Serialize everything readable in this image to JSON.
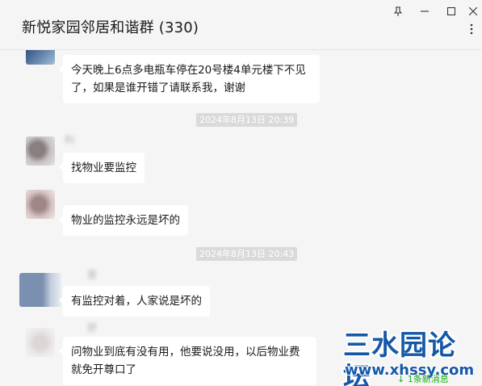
{
  "window": {
    "title": "新悦家园邻居和谐群 (330)",
    "controls": {
      "pin": "⊥",
      "minimize": "—",
      "maximize": "□",
      "close": "✕",
      "more": "⋮"
    }
  },
  "messages": [
    {
      "text": "今天晚上6点多电瓶车停在20号楼4单元楼下不见了，如果是谁开错了请联系我，谢谢"
    },
    {
      "timestamp": "2024年8月13日 20:39"
    },
    {
      "sender": "利",
      "text": "找物业要监控"
    },
    {
      "sender": "",
      "text": "物业的监控永远是坏的"
    },
    {
      "timestamp": "2024年8月13日 20:43"
    },
    {
      "sender": "度",
      "text": "有监控对着，人家说是坏的"
    },
    {
      "sender": "舒",
      "text": "问物业到底有没有用，他要说没用，以后物业费就免开尊口了"
    }
  ],
  "watermark": {
    "title": "三水园论坛",
    "url": "www.xhssy.com"
  },
  "new_message_notice": "↓ 1条新消息",
  "colors": {
    "background": "#f5f5f5",
    "bubble": "#ffffff",
    "timestamp_bg": "#dadada",
    "watermark_blue": "#1558a8",
    "new_message_green": "#1aad19"
  }
}
